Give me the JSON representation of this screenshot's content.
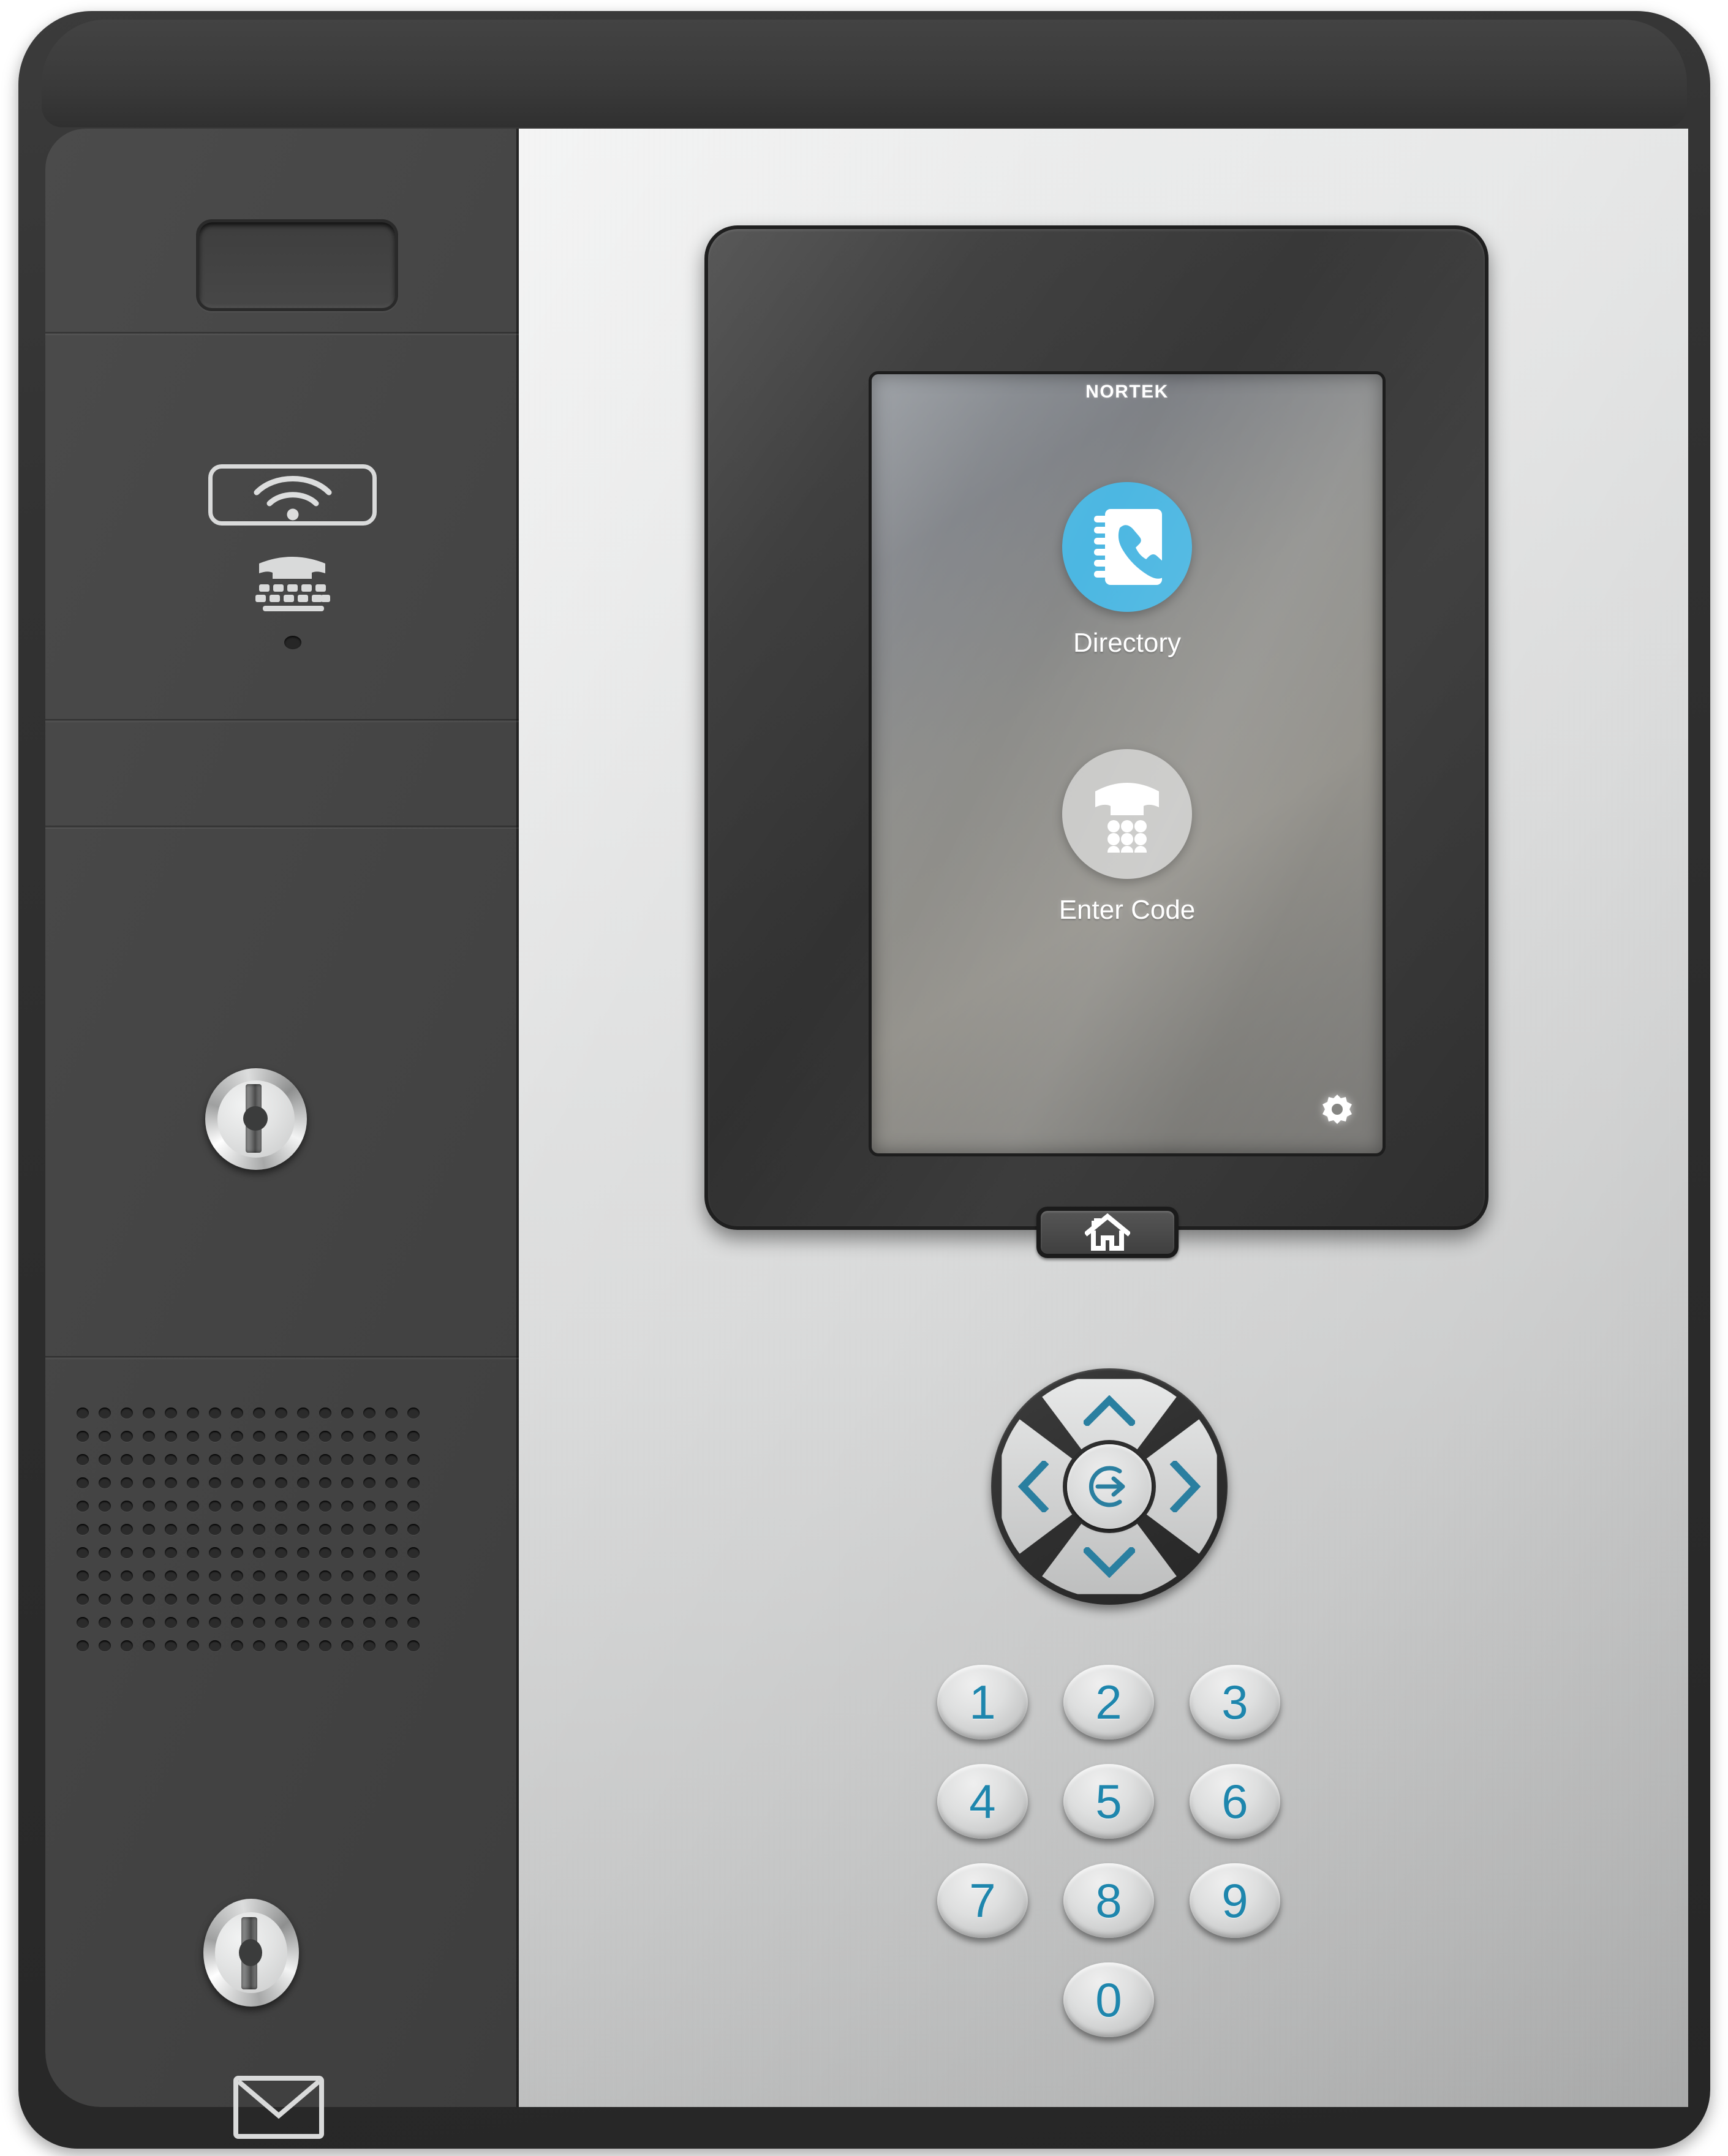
{
  "device": {
    "name": "Nortek Security & Control telephone entry intercom panel",
    "brand_accent": "#4ca3c4",
    "key_text_color": "#1e86ad"
  },
  "left_panel": {
    "camera_recess_name": "camera-window",
    "icons": [
      {
        "name": "wifi-icon",
        "label": "Wi-Fi / contactless reader"
      },
      {
        "name": "tty-icon",
        "label": "TTY teletypewriter accessible"
      },
      {
        "name": "tty-indicator-dot",
        "label": "TTY indicator"
      },
      {
        "name": "envelope-icon",
        "label": "Mail slot"
      }
    ],
    "locks": [
      {
        "name": "upper-key-lock",
        "label": "Upper key cylinder lock"
      },
      {
        "name": "lower-key-lock",
        "label": "Lower key cylinder lock"
      }
    ],
    "speaker": {
      "name": "speaker-grille",
      "columns": 16,
      "rows": 11
    }
  },
  "screen": {
    "titlebar": "NORTEK",
    "titlebar_color": "#4ca3c4",
    "tiles": [
      {
        "id": "directory",
        "label": "Directory",
        "icon": "address-book-phone-icon",
        "circle_color": "#4cb7e2",
        "glyph_color": "#ffffff",
        "selected": true
      },
      {
        "id": "enter-code",
        "label": "Enter Code",
        "icon": "phone-keypad-icon",
        "circle_color": "#c8c8c6",
        "glyph_color": "#ffffff",
        "selected": false
      }
    ],
    "settings_icon": "gear-icon"
  },
  "home_button": {
    "name": "home-button",
    "icon": "house-icon"
  },
  "dpad": {
    "name": "navigation-dpad",
    "up": "chevron-up-icon",
    "down": "chevron-down-icon",
    "left": "chevron-left-icon",
    "right": "chevron-right-icon",
    "center": "enter-arrow-icon"
  },
  "keypad": {
    "name": "numeric-keypad",
    "keys": [
      "1",
      "2",
      "3",
      "4",
      "5",
      "6",
      "7",
      "8",
      "9",
      "0"
    ]
  }
}
